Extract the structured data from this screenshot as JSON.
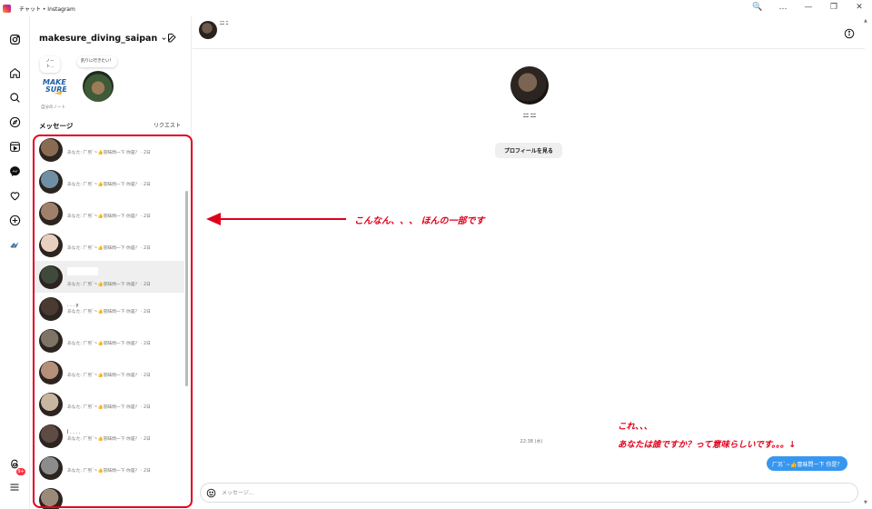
{
  "window": {
    "title": "チャット • Instagram",
    "controls": {
      "zoom": "🔍",
      "more": "…",
      "minimize": "—",
      "restore": "❐",
      "close": "✕"
    }
  },
  "sidebar": {
    "notification_badge": "9+",
    "icons": [
      "instagram-logo-icon",
      "home-icon",
      "search-icon",
      "explore-icon",
      "reels-icon",
      "messenger-icon",
      "heart-icon",
      "create-icon",
      "profile-avatar-icon",
      "threads-icon",
      "menu-icon"
    ]
  },
  "inbox": {
    "account_name": "makesure_diving_saipan",
    "notes": {
      "own_note": "ノート...",
      "friend_note": "釣りに行きたい！",
      "own_caption": "自分のノート"
    },
    "section_messages": "メッセージ",
    "section_requests": "リクエスト",
    "threads": [
      {
        "name": "",
        "preview": "あなた: 厂另ˋ~👍冒昧問一下 你是？ · 2日",
        "color": "#8a6b52",
        "active": false
      },
      {
        "name": "",
        "preview": "あなた: 厂另ˋ~👍冒昧問一下 你是？ · 2日",
        "color": "#6f8fa6",
        "active": false
      },
      {
        "name": "",
        "preview": "あなた: 厂另ˋ~👍冒昧問一下 你是？ · 2日",
        "color": "#a0806a",
        "active": false
      },
      {
        "name": "",
        "preview": "あなた: 厂另ˋ~👍冒昧問一下 你是？ · 2日",
        "color": "#e8d0c0",
        "active": false
      },
      {
        "name": "",
        "preview": "あなた: 厂另ˋ~👍冒昧問一下 你是？ · 2日",
        "color": "#3f4a3c",
        "active": true
      },
      {
        "name": ". . . y",
        "preview": "あなた: 厂另ˋ~👍冒昧問一下 你是？ · 2日",
        "color": "#4a3a32",
        "active": false
      },
      {
        "name": "",
        "preview": "あなた: 厂另ˋ~👍冒昧問一下 你是？ · 2日",
        "color": "#7d7466",
        "active": false
      },
      {
        "name": "",
        "preview": "あなた: 厂另ˋ~👍冒昧問一下 你是？ · 2日",
        "color": "#b48f7a",
        "active": false
      },
      {
        "name": "",
        "preview": "あなた: 厂另ˋ~👍冒昧問一下 你是？ · 2日",
        "color": "#c7b6a0",
        "active": false
      },
      {
        "name": "Ì . . . .",
        "preview": "あなた: 厂另ˋ~👍冒昧問一下 你是？ · 2日",
        "color": "#5d4b44",
        "active": false
      },
      {
        "name": "",
        "preview": "あなた: 厂另ˋ~👍冒昧問一下 你是？ · 2日",
        "color": "#8c8c8c",
        "active": false
      },
      {
        "name": "",
        "preview": "",
        "color": "#9a8a7a",
        "active": false
      }
    ]
  },
  "chat": {
    "header_name": "ﾆﾆ ﾆ",
    "profile_name": "ﾆﾆ ﾆﾆ",
    "view_profile_label": "プロフィールを見る",
    "timestamp": "22:38 (水)",
    "message_text": "厂另ˋ~👍冒昧問一下 你是？",
    "composer_placeholder": "メッセージ..."
  },
  "annotations": {
    "arrow_note": "こんなん、、、 ほんの一部です",
    "line1": "これ、、、",
    "line2": "あなたは誰ですか？って意味らしいです。。。↓"
  },
  "colors": {
    "accent": "#3797f0",
    "annotation_red": "#e0001b",
    "badge": "#ff3040"
  }
}
